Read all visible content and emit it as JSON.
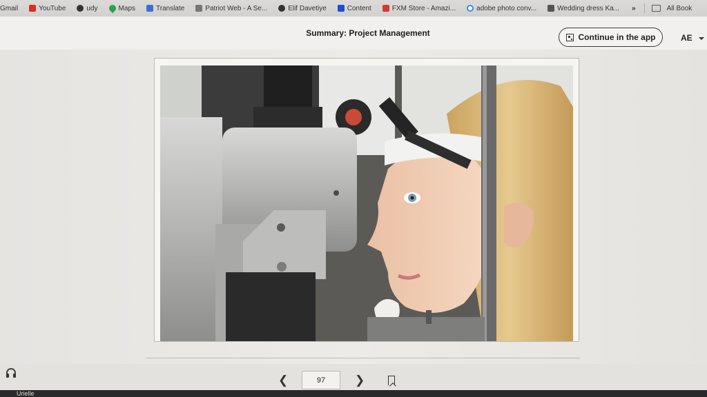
{
  "bookmarks": [
    {
      "label": "Gmail",
      "color": ""
    },
    {
      "label": "YouTube",
      "color": "#e02b20"
    },
    {
      "label": "udy",
      "color": "#333333"
    },
    {
      "label": "Maps",
      "color": "#2f9e4a"
    },
    {
      "label": "Translate",
      "color": "#3b6fd6"
    },
    {
      "label": "Patriot Web - A Se...",
      "color": "#777777"
    },
    {
      "label": "Elif Davetiye",
      "color": "#333333"
    },
    {
      "label": "Content",
      "color": "#1d4ed8"
    },
    {
      "label": "FXM Store - Amazi...",
      "color": "#d23b2e"
    },
    {
      "label": "adobe photo conv...",
      "color": "#4285f4"
    },
    {
      "label": "Wedding dress Ka...",
      "color": "#555555"
    }
  ],
  "bookmarks_more": "»",
  "bookmarks_folder": "All Book",
  "header": {
    "title": "Summary: Project Management",
    "continue_label": "Continue in the app",
    "language": "AE"
  },
  "pager": {
    "page": "97",
    "prev_icon": "chevron-left-icon",
    "next_icon": "chevron-right-icon"
  },
  "taskbar": {
    "label": "Urielle"
  }
}
